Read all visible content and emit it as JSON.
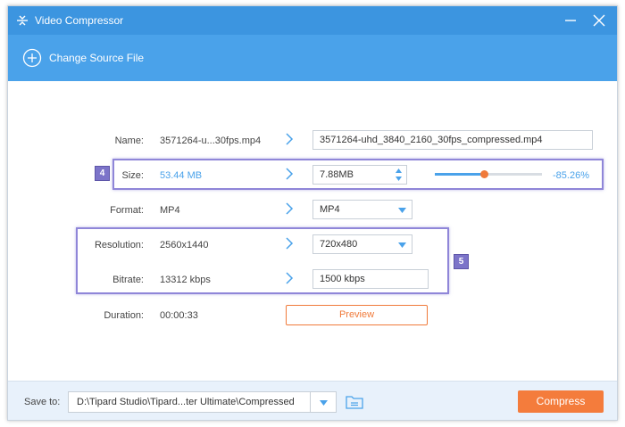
{
  "window": {
    "title": "Video Compressor",
    "accent_color": "#3c95e0",
    "toolbar_color": "#4aa2ea",
    "action_color": "#f47c3c"
  },
  "toolbar": {
    "change_source_label": "Change Source File",
    "change_source_icon": "plus-circle-icon"
  },
  "form": {
    "name": {
      "label": "Name:",
      "source": "3571264-u...30fps.mp4",
      "output": "3571264-uhd_3840_2160_30fps_compressed.mp4"
    },
    "size": {
      "label": "Size:",
      "source": "53.44 MB",
      "output": "7.88MB",
      "percent": "-85.26%",
      "slider_fraction": 0.46
    },
    "format": {
      "label": "Format:",
      "source": "MP4",
      "output": "MP4"
    },
    "resolution": {
      "label": "Resolution:",
      "source": "2560x1440",
      "output": "720x480"
    },
    "bitrate": {
      "label": "Bitrate:",
      "source": "13312 kbps",
      "output": "1500 kbps"
    },
    "duration": {
      "label": "Duration:",
      "source": "00:00:33"
    }
  },
  "preview_label": "Preview",
  "badges": {
    "size": "4",
    "res_bitrate": "5"
  },
  "footer": {
    "save_to_label": "Save to:",
    "save_path": "D:\\Tipard Studio\\Tipard...ter Ultimate\\Compressed",
    "compress_label": "Compress"
  }
}
